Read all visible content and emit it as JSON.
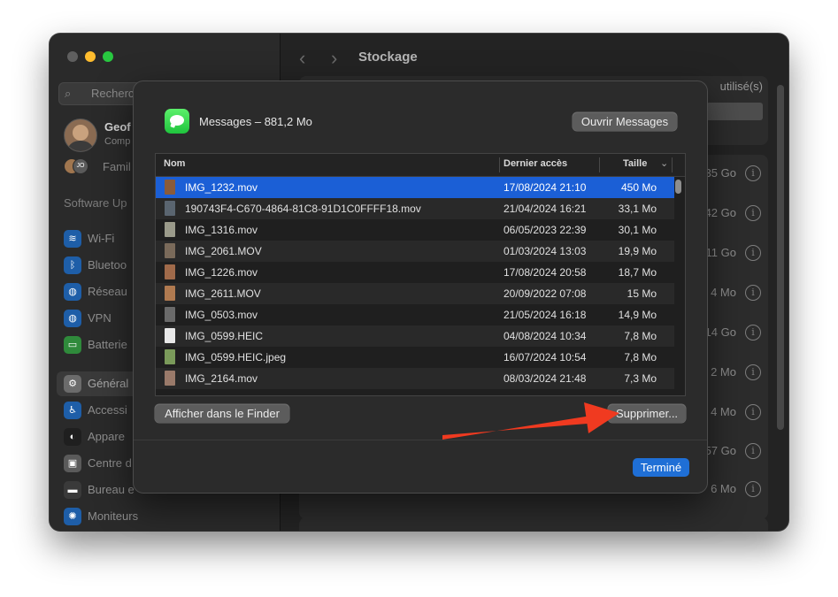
{
  "window": {
    "title": "Stockage",
    "back_glyph": "‹",
    "forward_glyph": "›"
  },
  "sidebar": {
    "search_placeholder": "Recherch",
    "user": {
      "name": "Geof",
      "subtitle": "Comp"
    },
    "family": {
      "label": "Famil",
      "initials": "JO"
    },
    "software_update": "Software Up",
    "items": [
      {
        "label": "Wi-Fi",
        "icon": "wifi-icon",
        "glyph": "≋",
        "color": "#1e5ea8"
      },
      {
        "label": "Bluetoo",
        "icon": "bluetooth-icon",
        "glyph": "ᛒ",
        "color": "#1e5ea8"
      },
      {
        "label": "Réseau",
        "icon": "globe-icon",
        "glyph": "◍",
        "color": "#1e5ea8"
      },
      {
        "label": "VPN",
        "icon": "vpn-globe-icon",
        "glyph": "◍",
        "color": "#1e5ea8"
      },
      {
        "label": "Batterie",
        "icon": "battery-icon",
        "glyph": "▭",
        "color": "#2f8a3b"
      },
      {
        "label": "Général",
        "icon": "gear-icon",
        "glyph": "⚙",
        "color": "#6b6b6b"
      },
      {
        "label": "Accessi",
        "icon": "accessibility-icon",
        "glyph": "♿",
        "color": "#1e5ea8"
      },
      {
        "label": "Appare",
        "icon": "appearance-icon",
        "glyph": "◐",
        "color": "#1f1f1f"
      },
      {
        "label": "Centre d",
        "icon": "control-center-icon",
        "glyph": "▣",
        "color": "#5a5a5a"
      },
      {
        "label": "Bureau e",
        "icon": "desktop-dock-icon",
        "glyph": "▬",
        "color": "#3a3a3a"
      },
      {
        "label": "Moniteurs",
        "icon": "display-icon",
        "glyph": "✺",
        "color": "#1e5ea8"
      }
    ]
  },
  "background": {
    "used_label": "utilisé(s)",
    "sizes": [
      "35 Go",
      "42 Go",
      "11 Go",
      "4 Mo",
      "14 Go",
      "2 Mo",
      "4 Mo",
      "57 Go",
      "6 Mo"
    ],
    "info_glyph": "i"
  },
  "dialog": {
    "app_title": "Messages – 881,2 Mo",
    "open_button": "Ouvrir Messages",
    "columns": {
      "name": "Nom",
      "accessed": "Dernier accès",
      "size": "Taille"
    },
    "sort_glyph": "⌄",
    "rows": [
      {
        "name": "IMG_1232.mov",
        "date": "17/08/2024 21:10",
        "size": "450 Mo",
        "selected": true,
        "thumb": "#8a5b3a"
      },
      {
        "name": "190743F4-C670-4864-81C8-91D1C0FFFF18.mov",
        "date": "21/04/2024 16:21",
        "size": "33,1 Mo",
        "selected": false,
        "thumb": "#5a6570"
      },
      {
        "name": "IMG_1316.mov",
        "date": "06/05/2023 22:39",
        "size": "30,1 Mo",
        "selected": false,
        "thumb": "#9a9a8a"
      },
      {
        "name": "IMG_2061.MOV",
        "date": "01/03/2024 13:03",
        "size": "19,9 Mo",
        "selected": false,
        "thumb": "#7a6a5a"
      },
      {
        "name": "IMG_1226.mov",
        "date": "17/08/2024 20:58",
        "size": "18,7 Mo",
        "selected": false,
        "thumb": "#a06a4a"
      },
      {
        "name": "IMG_2611.MOV",
        "date": "20/09/2022 07:08",
        "size": "15 Mo",
        "selected": false,
        "thumb": "#b07a50"
      },
      {
        "name": "IMG_0503.mov",
        "date": "21/05/2024 16:18",
        "size": "14,9 Mo",
        "selected": false,
        "thumb": "#6a6a6a"
      },
      {
        "name": "IMG_0599.HEIC",
        "date": "04/08/2024 10:34",
        "size": "7,8 Mo",
        "selected": false,
        "thumb": "#e8e8e8"
      },
      {
        "name": "IMG_0599.HEIC.jpeg",
        "date": "16/07/2024 10:54",
        "size": "7,8 Mo",
        "selected": false,
        "thumb": "#7a9a5a"
      },
      {
        "name": "IMG_2164.mov",
        "date": "08/03/2024 21:48",
        "size": "7,3 Mo",
        "selected": false,
        "thumb": "#9a7a6a"
      }
    ],
    "finder_button": "Afficher dans le Finder",
    "delete_button": "Supprimer...",
    "done_button": "Terminé"
  },
  "colors": {
    "selection": "#1b5fd6",
    "accent": "#1f6fd6",
    "annotation_arrow": "#f03a20"
  }
}
